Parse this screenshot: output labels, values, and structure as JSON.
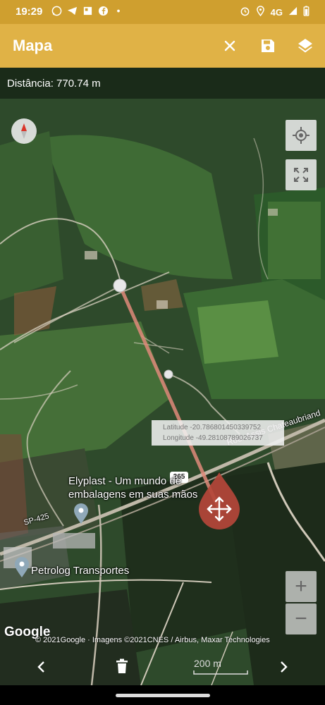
{
  "status_bar": {
    "time": "19:29",
    "network": "4G"
  },
  "app_bar": {
    "title": "Mapa",
    "icons": [
      "close-icon",
      "save-icon",
      "layers-icon"
    ]
  },
  "map": {
    "distance_label": "Distância: 770.74 m",
    "coords": {
      "latitude_line": "Latitude -20.786801450339752",
      "longitude_line": "Longitude -49.28108789026737"
    },
    "road_label": "Rod. Assis Chateaubriand",
    "road_shield": "265",
    "road_sp": "SP-425",
    "places": {
      "elyplast_line1": "Elyplast - Um mundo de",
      "elyplast_line2": "embalagens em suas mãos",
      "petrolog": "Petrolog Transportes"
    },
    "google_logo": "Google",
    "copyright": "© 2021Google · Imagens ©2021CNES / Airbus, Maxar Technologies",
    "zoom_in": "+",
    "zoom_out": "−"
  },
  "bottom_controls": {
    "scale": "200 m",
    "icons": [
      "chevron-left-icon",
      "delete-icon",
      "chevron-right-icon"
    ]
  },
  "colors": {
    "status_bar": "#cf9f2f",
    "app_bar": "#e0b246",
    "route_line": "#e08a7a",
    "marker": "#b5473a"
  }
}
